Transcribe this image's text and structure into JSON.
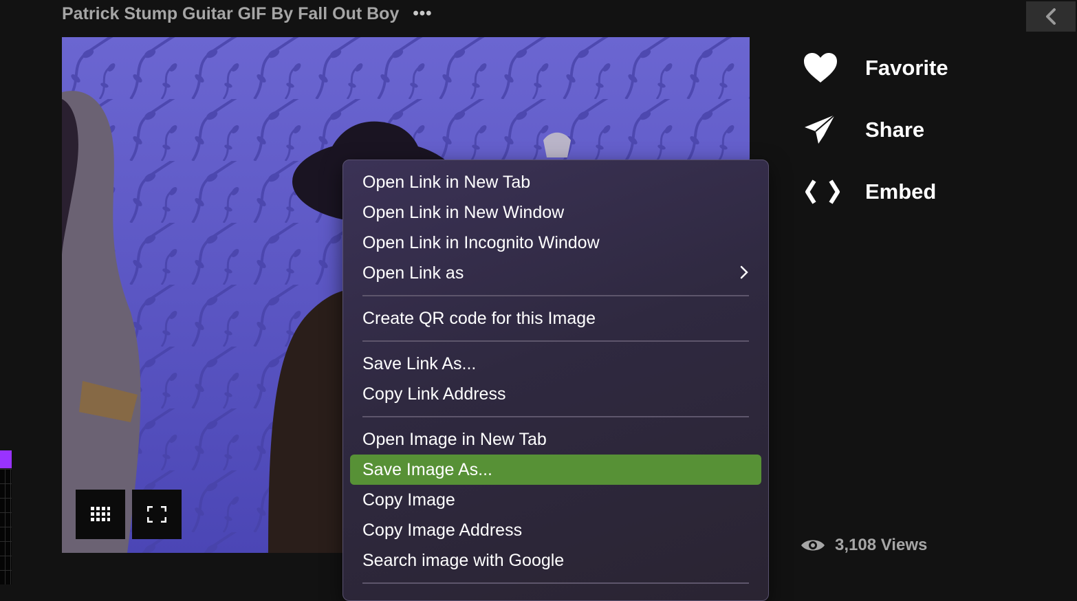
{
  "header": {
    "title": "Patrick Stump Guitar GIF By Fall Out Boy",
    "more_label": "•••"
  },
  "gif": {
    "controls": [
      "grid-icon",
      "fullscreen-icon"
    ]
  },
  "actions": [
    {
      "label": "Favorite",
      "icon": "heart-icon"
    },
    {
      "label": "Share",
      "icon": "paper-plane-icon"
    },
    {
      "label": "Embed",
      "icon": "code-brackets-icon"
    }
  ],
  "stats": {
    "views": "3,108 Views",
    "icon": "eye-icon"
  },
  "context_menu": {
    "items": [
      {
        "label": "Open Link in New Tab"
      },
      {
        "label": "Open Link in New Window"
      },
      {
        "label": "Open Link in Incognito Window"
      },
      {
        "label": "Open Link as"
      },
      {
        "label": "Create QR code for this Image"
      },
      {
        "label": "Save Link As..."
      },
      {
        "label": "Copy Link Address"
      },
      {
        "label": "Open Image in New Tab"
      },
      {
        "label": "Save Image As..."
      },
      {
        "label": "Copy Image"
      },
      {
        "label": "Copy Image Address"
      },
      {
        "label": "Search image with Google"
      }
    ],
    "selected": "Save Image As...",
    "highlight_color": "#579136"
  },
  "colors": {
    "background": "#121212",
    "accent_purple": "#9933ff"
  }
}
